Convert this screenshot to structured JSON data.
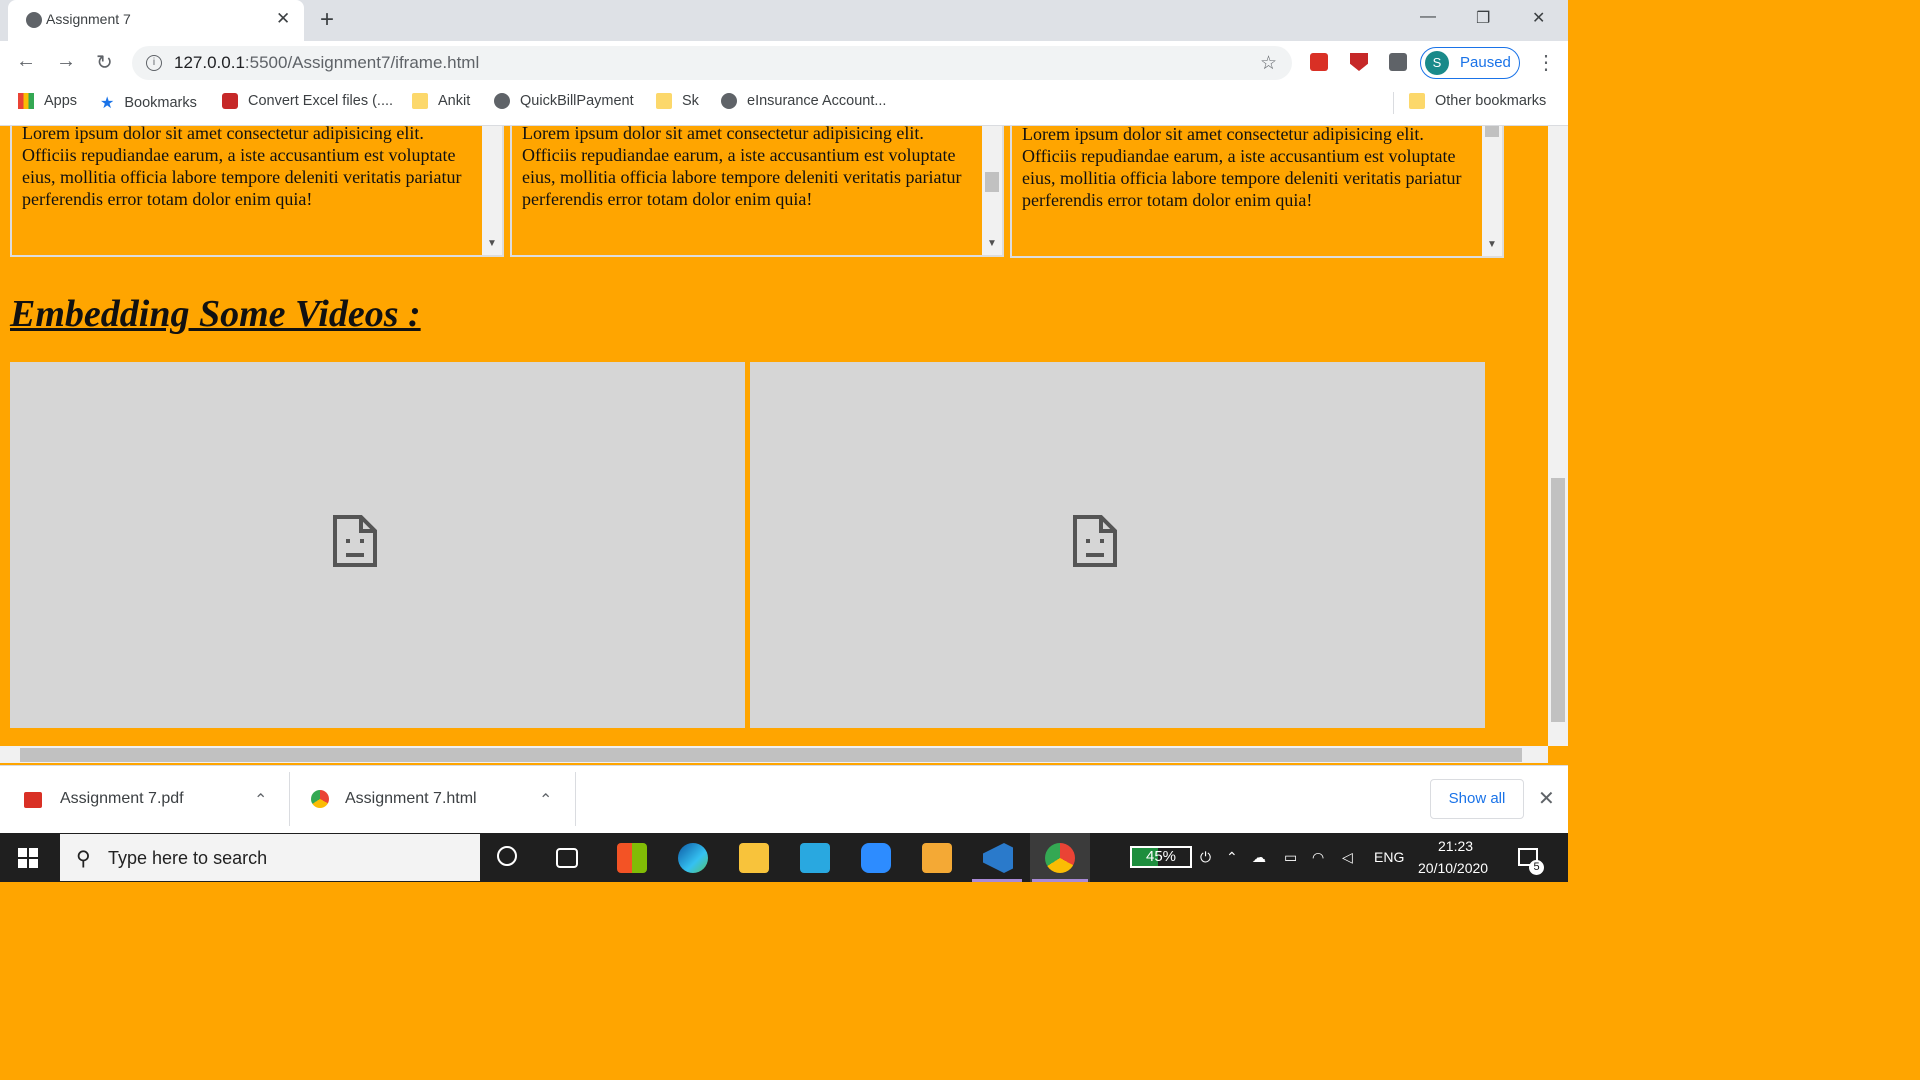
{
  "browser": {
    "tab_title": "Assignment 7",
    "tab_close": "✕",
    "new_tab": "+",
    "url_host": "127.0.0.1",
    "url_path": ":5500/Assignment7/iframe.html",
    "profile_initial": "S",
    "profile_status": "Paused",
    "window_minimize": "—",
    "window_restore": "❐",
    "window_close": "✕"
  },
  "bookmarks": {
    "apps": "Apps",
    "bookmarks": "Bookmarks",
    "convert": "Convert Excel files (....",
    "ankit": "Ankit",
    "quickbill": "QuickBillPayment",
    "sk": "Sk",
    "einsurance": "eInsurance Account...",
    "other": "Other bookmarks"
  },
  "page": {
    "frame_text": "Lorem ipsum dolor sit amet consectetur adipisicing elit. Officiis repudiandae earum, a iste accusantium est voluptate eius, mollitia officia labore tempore deleniti veritatis pariatur perferendis error totam dolor enim quia!",
    "heading": "Embedding Some Videos :"
  },
  "downloads": {
    "file1": "Assignment 7.pdf",
    "file2": "Assignment 7.html",
    "show_all": "Show all"
  },
  "taskbar": {
    "search_placeholder": "Type here to search",
    "battery": "45%",
    "language": "ENG",
    "time": "21:23",
    "date": "20/10/2020",
    "notifications": "5"
  },
  "colors": {
    "page_background": "#ffa500",
    "video_placeholder": "#d6d6d6",
    "accent": "#1a73e8"
  }
}
